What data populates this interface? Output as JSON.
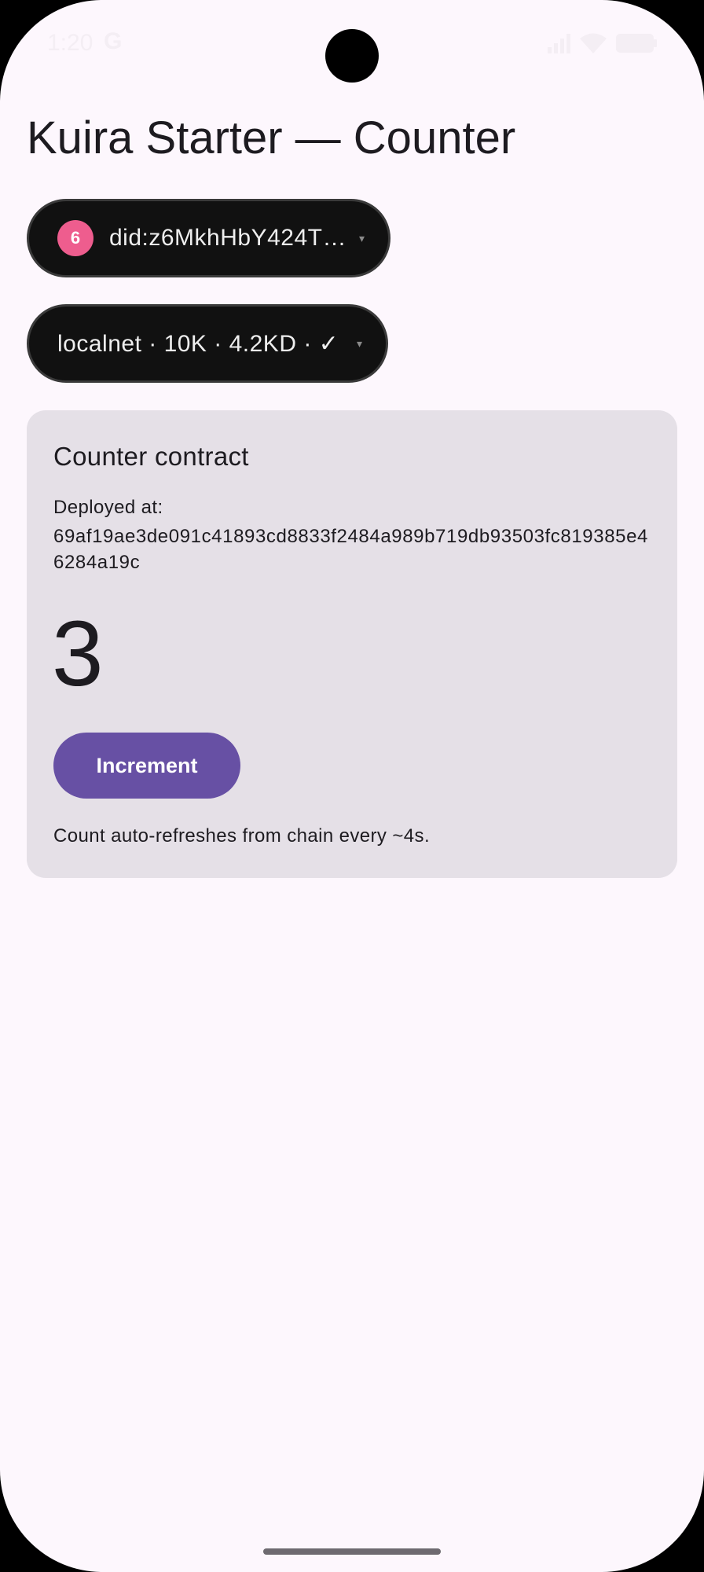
{
  "status_bar": {
    "time": "1:20",
    "google_glyph": "G",
    "icons": [
      "signal-icon",
      "wifi-icon",
      "battery-icon"
    ]
  },
  "header": {
    "title": "Kuira Starter — Counter"
  },
  "account_selector": {
    "avatar_label": "6",
    "avatar_color": "#ee5d8e",
    "did": "did:z6MkhHbY424T…",
    "caret": "▾"
  },
  "network_selector": {
    "label": "localnet · 10K · 4.2KD · ✓",
    "caret": "▾"
  },
  "counter_card": {
    "title": "Counter contract",
    "deployed_label": "Deployed at:",
    "address": "69af19ae3de091c41893cd8833f2484a989b719db93503fc819385e46284a19c",
    "count": "3",
    "increment_label": "Increment",
    "note": "Count auto-refreshes from chain every ~4s."
  },
  "colors": {
    "background": "#fdf7fd",
    "card": "#e5e0e7",
    "pill": "#111111",
    "accent": "#6750a4"
  }
}
